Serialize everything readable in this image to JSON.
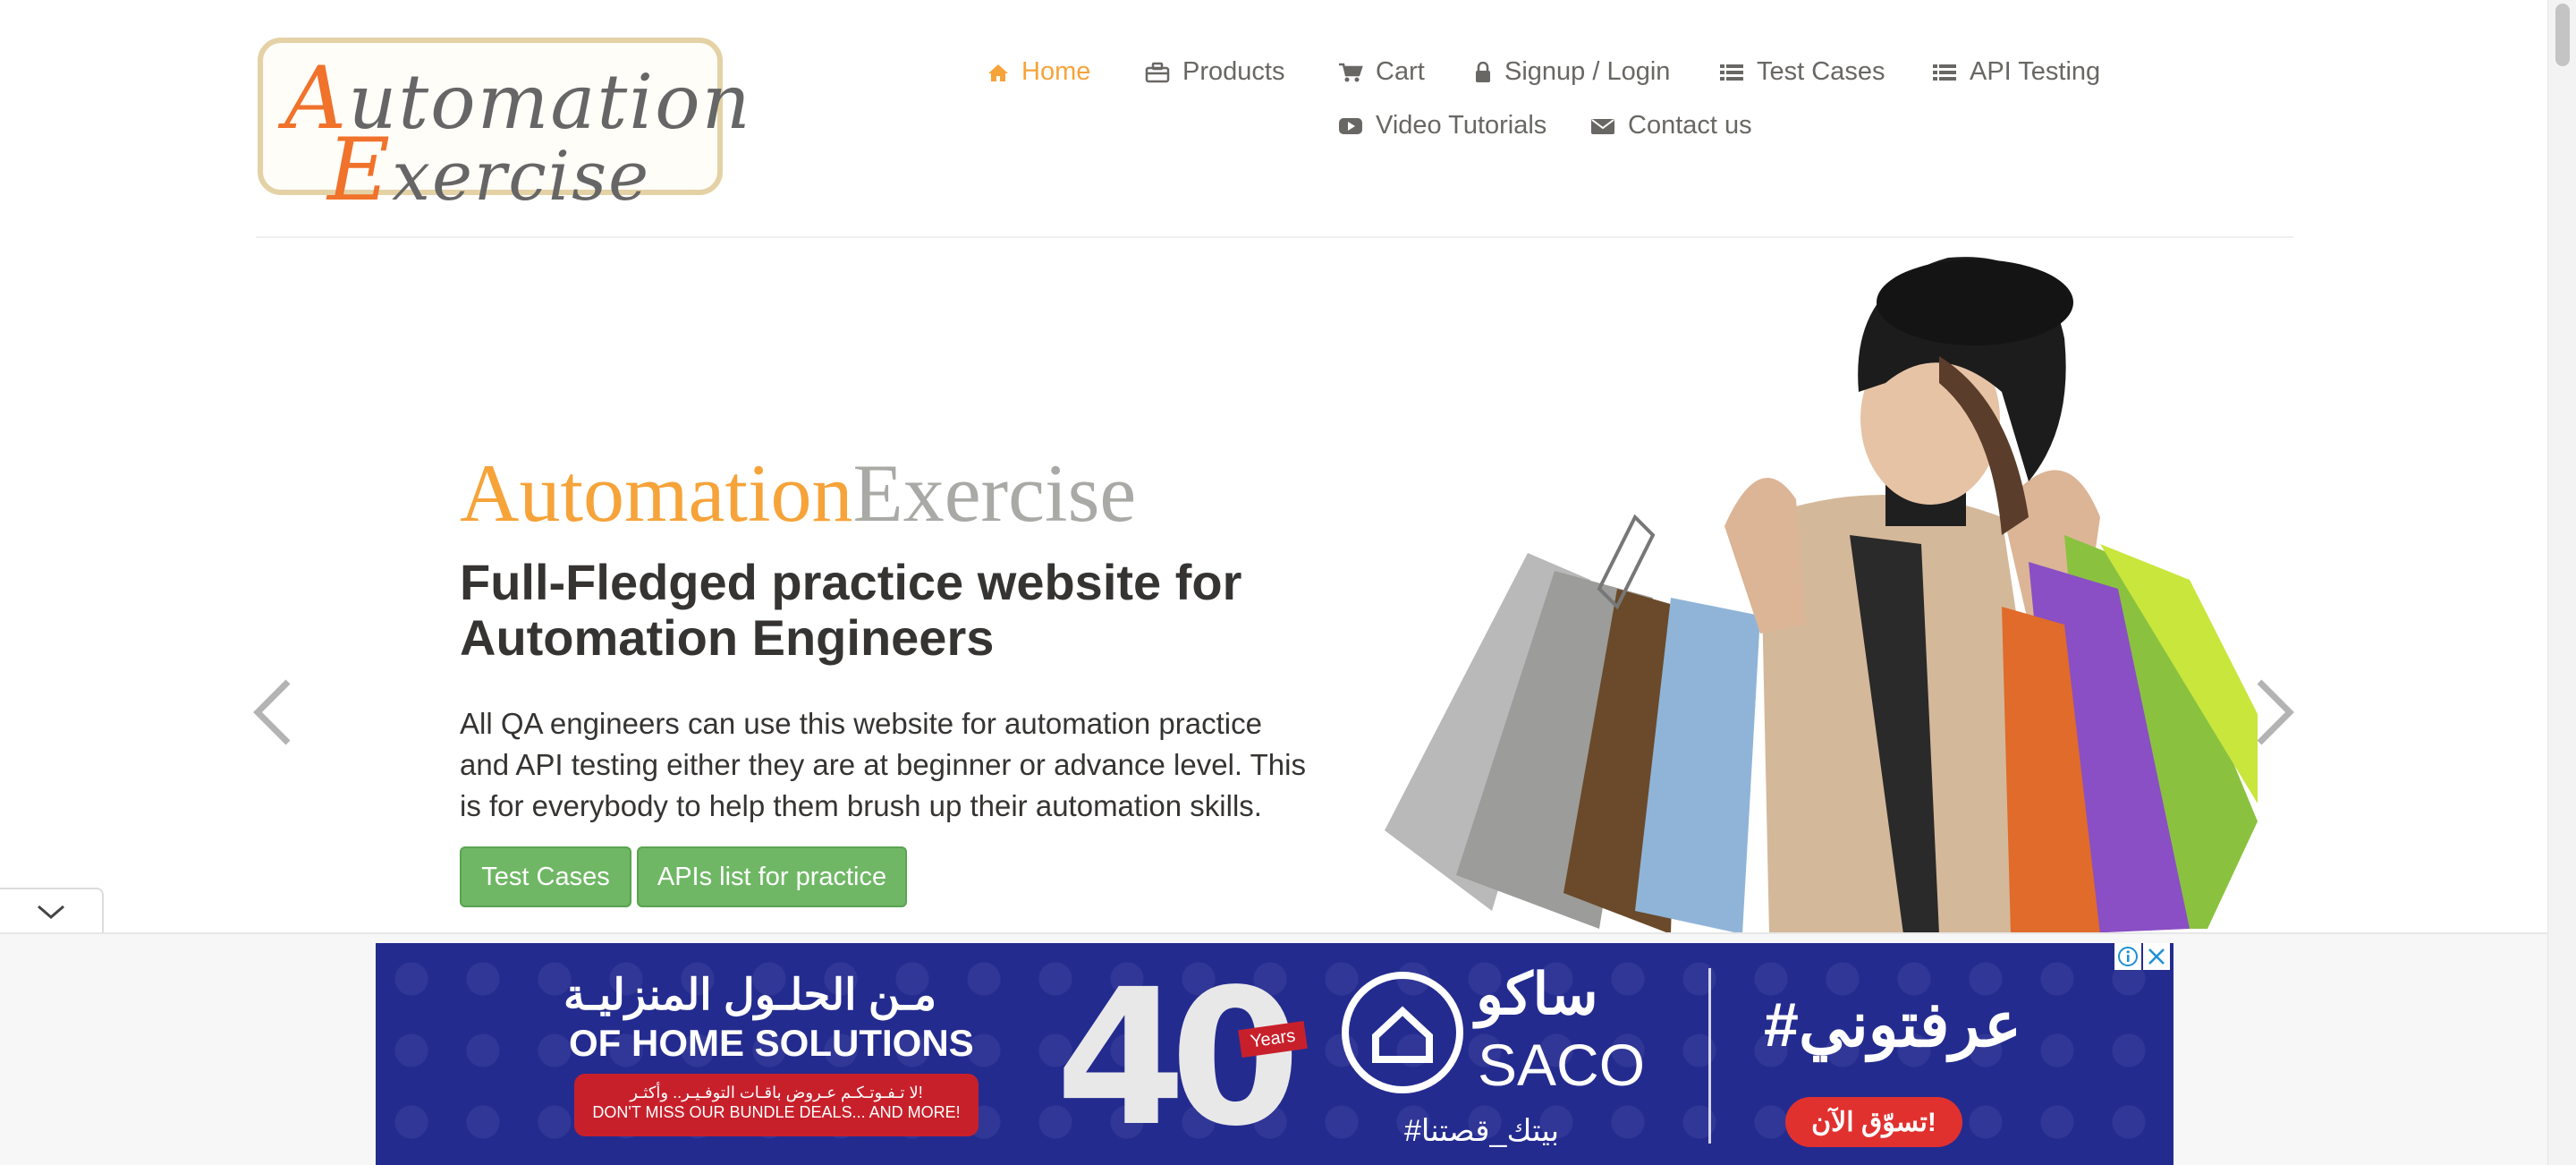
{
  "logo": {
    "line1_first": "A",
    "line1_rest": "utomation",
    "line2_first": "E",
    "line2_rest": "xercise"
  },
  "nav": {
    "items": [
      {
        "label": "Home",
        "icon": "home-icon"
      },
      {
        "label": "Products",
        "icon": "briefcase-icon"
      },
      {
        "label": "Cart",
        "icon": "cart-icon"
      },
      {
        "label": "Signup / Login",
        "icon": "lock-icon"
      },
      {
        "label": "Test Cases",
        "icon": "list-icon"
      },
      {
        "label": "API Testing",
        "icon": "list-icon"
      },
      {
        "label": "Video Tutorials",
        "icon": "youtube-icon"
      },
      {
        "label": "Contact us",
        "icon": "envelope-icon"
      }
    ],
    "active": "Home"
  },
  "hero": {
    "title_part1": "Automation",
    "title_part2": "Exercise",
    "heading": "Full-Fledged practice website for Automation Engineers",
    "description": "All QA engineers can use this website for automation practice and API testing either they are at beginner or advance level. This is for everybody to help them brush up their automation skills.",
    "btn_test_cases": "Test Cases",
    "btn_apis": "APIs list for practice"
  },
  "ad": {
    "arabic_line1": "مـن الحلـول المنزليـة",
    "english_line1": "OF HOME SOLUTIONS",
    "promo_ar": "لا تـفـوتـكـم عـروض باقـات التوفـيـر.. وأكثـر!",
    "promo_en": "DON'T MISS OUR BUNDLE DEALS... AND MORE!",
    "number": "40",
    "years_label": "Years",
    "brand_ar": "ساكو",
    "brand_en": "SACO",
    "hashtag_brand": "#بيتك_قصتنا",
    "hashtag_main": "#عرفتوني",
    "shop_now": "تسوّق الآن!"
  },
  "colors": {
    "accent": "#f6a33a",
    "button_green": "#6fb765",
    "ad_bg": "#242b8f",
    "ad_red": "#c8202b"
  }
}
